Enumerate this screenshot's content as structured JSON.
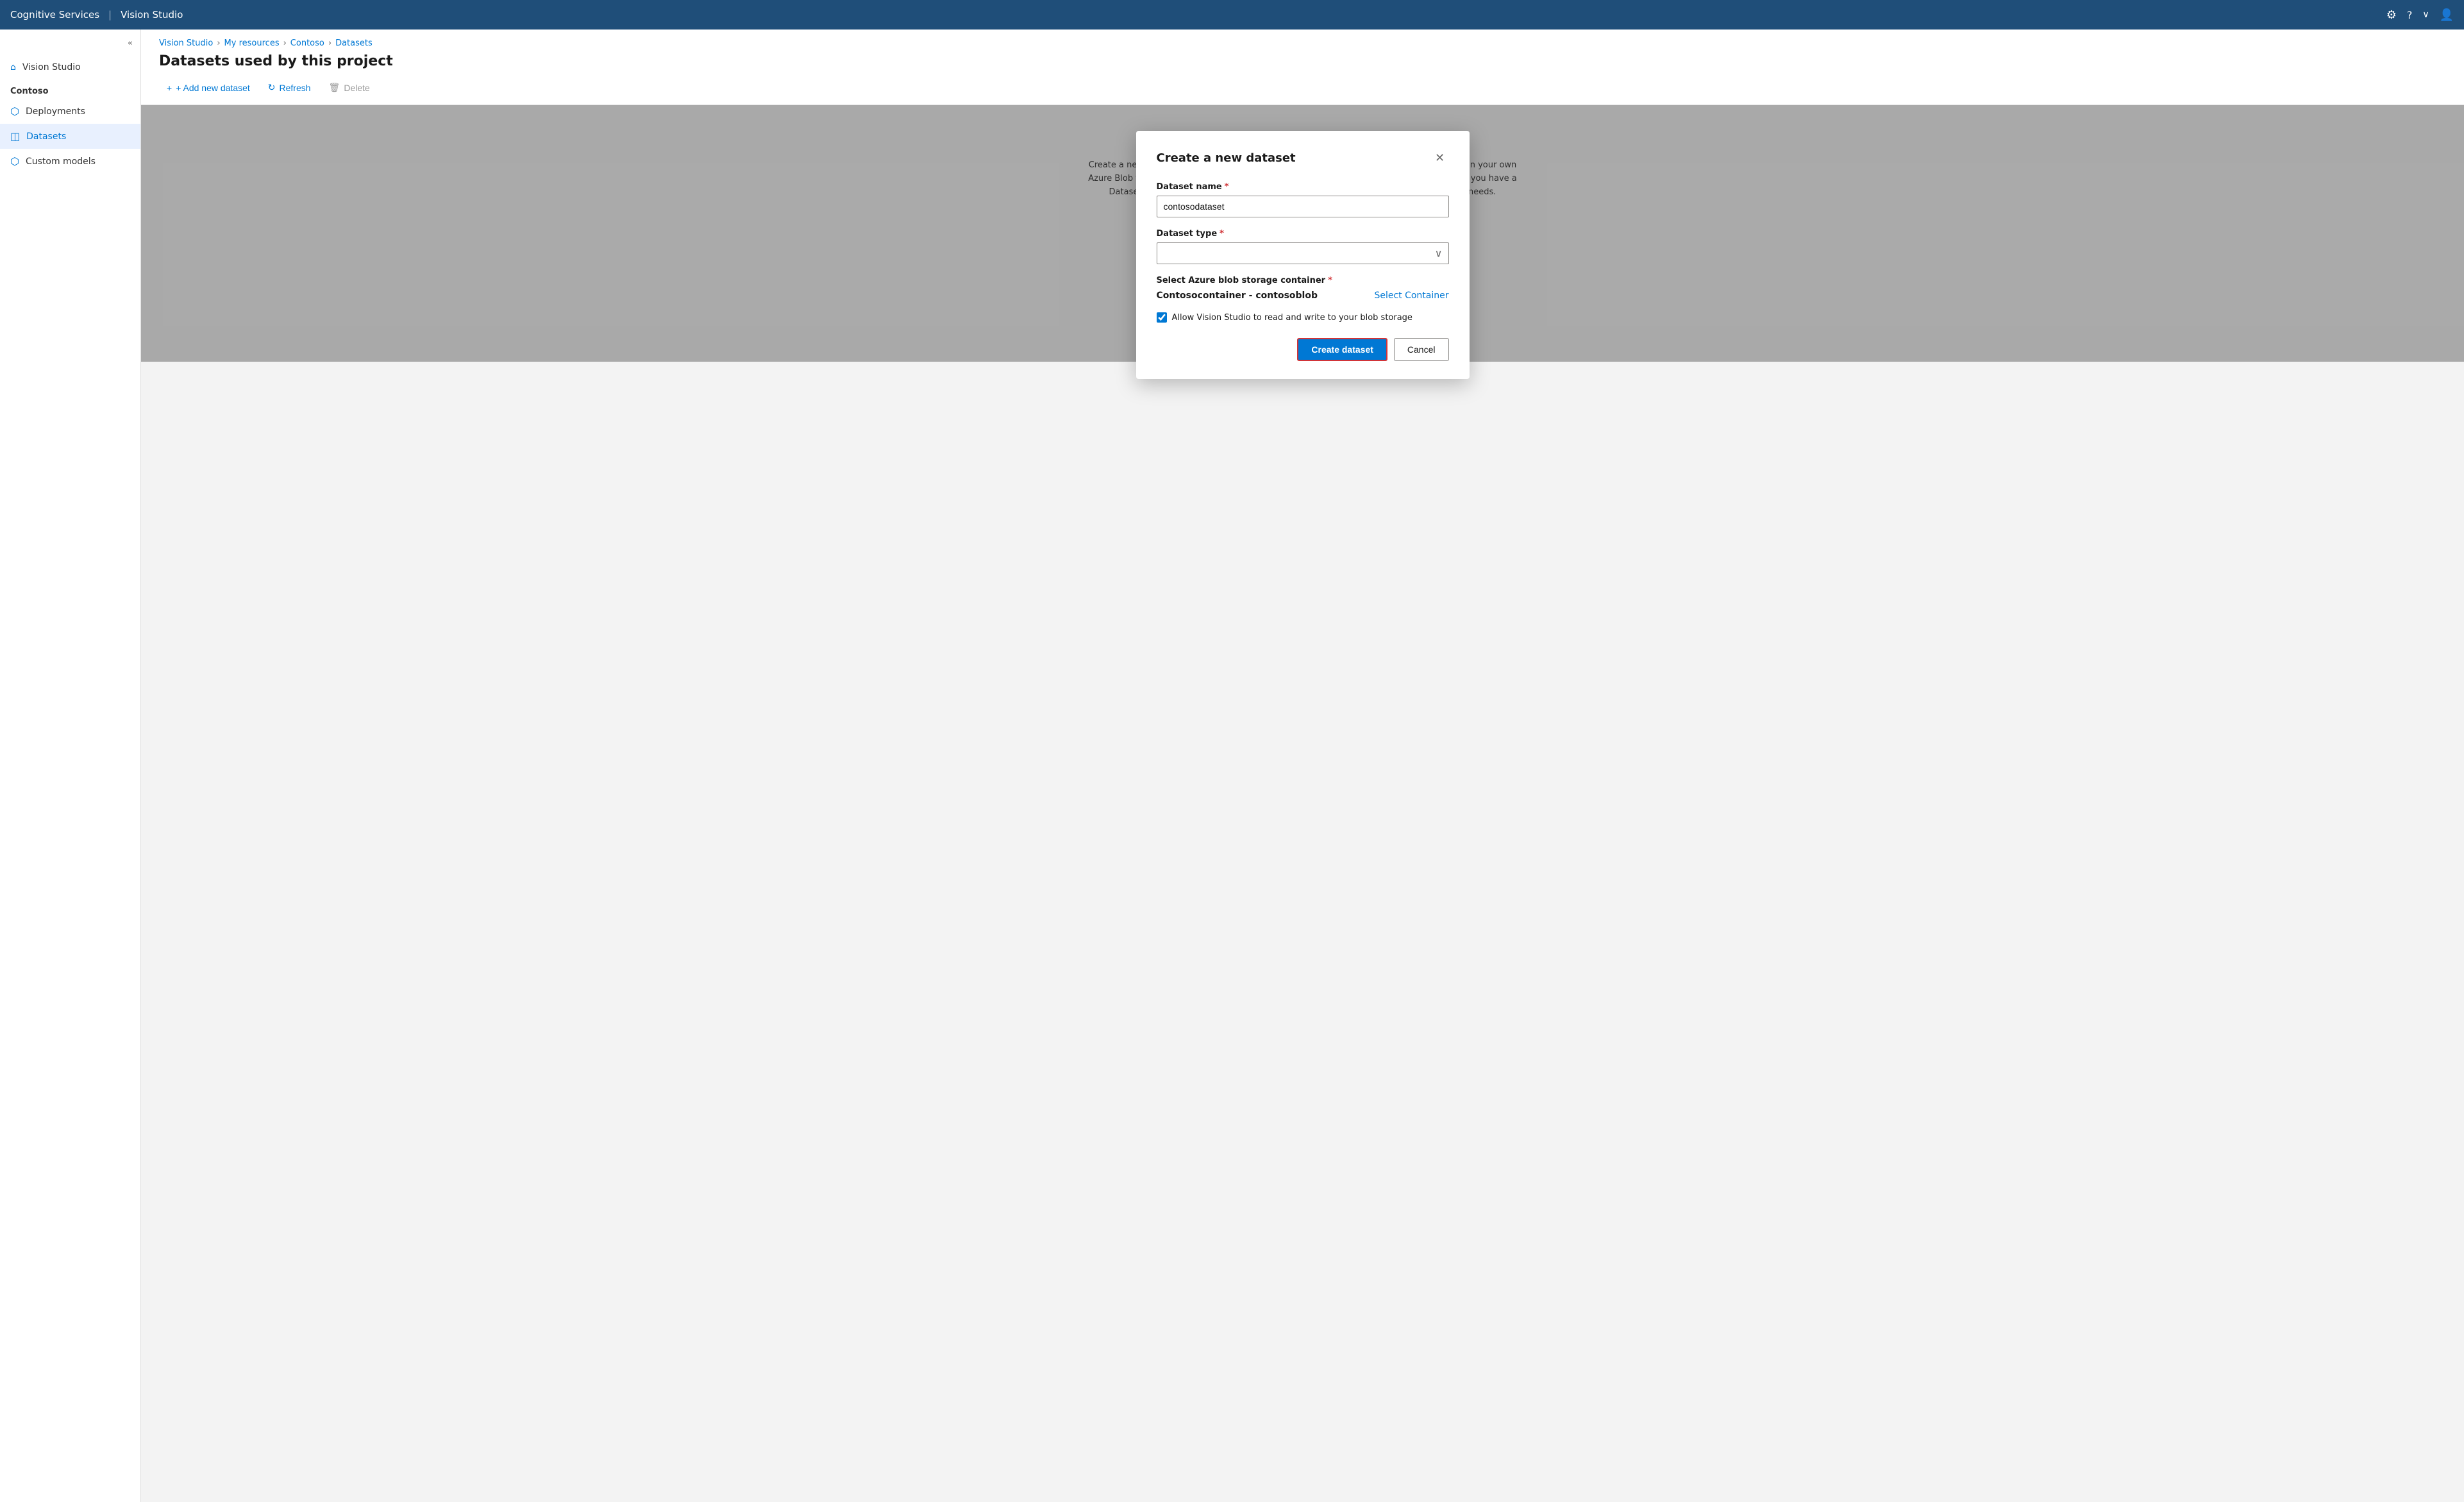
{
  "app": {
    "title": "Cognitive Services",
    "subtitle": "Vision Studio"
  },
  "topnav": {
    "settings_icon": "⚙",
    "help_icon": "?",
    "chevron_icon": "∨",
    "user_icon": "👤"
  },
  "sidebar": {
    "collapse_label": "«",
    "section_label": "Contoso",
    "items": [
      {
        "id": "vision-studio",
        "label": "Vision Studio",
        "icon": "🏠"
      },
      {
        "id": "deployments",
        "label": "Deployments",
        "icon": "⬡"
      },
      {
        "id": "datasets",
        "label": "Datasets",
        "icon": "◫",
        "active": true
      },
      {
        "id": "custom-models",
        "label": "Custom models",
        "icon": "⬡"
      }
    ]
  },
  "breadcrumb": {
    "items": [
      {
        "label": "Vision Studio",
        "link": true
      },
      {
        "label": "My resources",
        "link": true
      },
      {
        "label": "Contoso",
        "link": true
      },
      {
        "label": "Datasets",
        "link": true
      }
    ]
  },
  "page": {
    "title": "Datasets used by this project",
    "toolbar": {
      "add_label": "+ Add new dataset",
      "refresh_label": "Refresh",
      "delete_label": "Delete"
    },
    "info_text": "Create a new dataset to get started. You will be able to leverage images and labels stored in your own Azure Blob to create new datasets, as well as label images using Azure ML if needed. Once you have a Dataset, you can use it to train new Computer Vision models customized to your own needs."
  },
  "modal": {
    "title": "Create a new dataset",
    "dataset_name_label": "Dataset name",
    "dataset_name_value": "contosodataset",
    "dataset_type_label": "Dataset type",
    "dataset_type_placeholder": "",
    "storage_label": "Select Azure blob storage container",
    "storage_name": "Contosocontainer - contosoblob",
    "select_container_label": "Select Container",
    "checkbox_label": "Allow Vision Studio to read and write to your blob storage",
    "checkbox_checked": true,
    "create_button_label": "Create dataset",
    "cancel_button_label": "Cancel"
  }
}
